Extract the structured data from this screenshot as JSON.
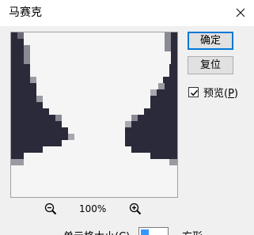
{
  "window": {
    "title": "马赛克"
  },
  "buttons": {
    "ok_label": "确定",
    "reset_label": "复位"
  },
  "preview_toggle": {
    "label": "预览(",
    "accel": "P",
    "label_end": ")",
    "checked": true
  },
  "zoom": {
    "level": "100%"
  },
  "cell_size": {
    "label": "单元格大小(C)",
    "value": "",
    "unit": "方形"
  },
  "colors": {
    "dark": "#2a2a3a",
    "light": "#f5f5f5",
    "accent": "#0078d7"
  },
  "icons": {
    "close": "close-icon",
    "zoom_out": "zoom-out-icon",
    "zoom_in": "zoom-in-icon",
    "check": "checkmark-icon"
  }
}
